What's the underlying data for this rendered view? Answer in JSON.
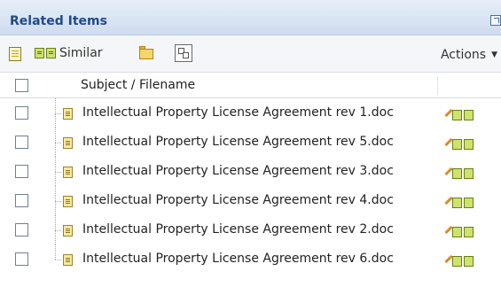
{
  "panel": {
    "title": "Related Items"
  },
  "toolbar": {
    "similar_label": "Similar",
    "actions_label": "Actions"
  },
  "grid": {
    "column_header": "Subject / Filename",
    "rows": [
      {
        "filename": "Intellectual Property License Agreement rev 1.doc"
      },
      {
        "filename": "Intellectual Property License Agreement rev 5.doc"
      },
      {
        "filename": "Intellectual Property License Agreement rev 3.doc"
      },
      {
        "filename": "Intellectual Property License Agreement rev 4.doc"
      },
      {
        "filename": "Intellectual Property License Agreement rev 2.doc"
      },
      {
        "filename": "Intellectual Property License Agreement rev 6.doc"
      }
    ]
  },
  "icons": {
    "list_view": "list-view-icon",
    "similar": "similar-docs-icon",
    "folder": "folder-icon",
    "copy": "copy-icon",
    "popout": "popout-icon",
    "document": "document-icon"
  },
  "colors": {
    "header_title": "#1f4a8a",
    "header_bg": "#cfdcef",
    "toolbar_bg": "#f4f6f9"
  }
}
